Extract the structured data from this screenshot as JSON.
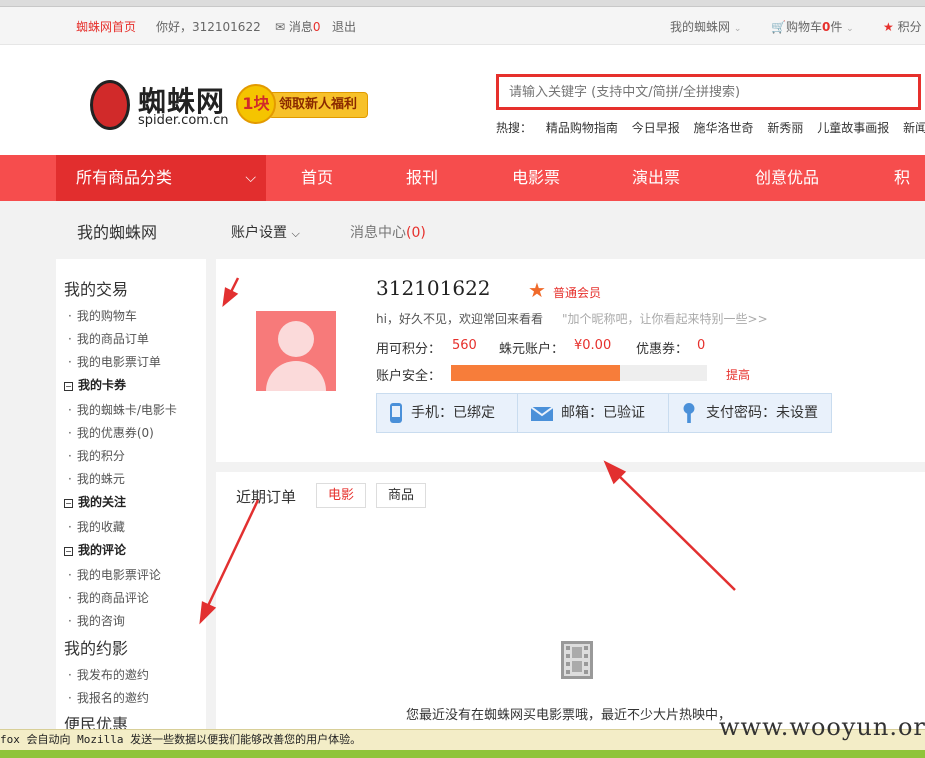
{
  "topbar": {
    "home": "蜘蛛网首页",
    "hello": "你好，312101622",
    "messages_label": "消息",
    "messages_count": "0",
    "logout": "退出",
    "my_spider": "我的蜘蛛网",
    "cart_label": "购物车",
    "cart_count": "0",
    "cart_unit": "件",
    "points": "积分"
  },
  "header": {
    "logo_text": "蜘蛛网",
    "logo_domain": "spider.com.cn",
    "promo_amount": "1块",
    "promo_text": "领取新人福利"
  },
  "search": {
    "placeholder": "请输入关键字 (支持中文/简拼/全拼搜索)",
    "hot_label": "热搜：",
    "hot": [
      "精品购物指南",
      "今日早报",
      "施华洛世奇",
      "新秀丽",
      "儿童故事画报",
      "新闻晨"
    ]
  },
  "nav": {
    "all_categories": "所有商品分类",
    "items": [
      "首页",
      "报刊",
      "电影票",
      "演出票",
      "创意优品",
      "积分"
    ]
  },
  "subnav": {
    "title": "我的蜘蛛网",
    "account": "账户设置",
    "messages": "消息中心",
    "messages_count": "(0)"
  },
  "sidebar": {
    "trade": "我的交易",
    "cart": "我的购物车",
    "goods_orders": "我的商品订单",
    "movie_orders": "我的电影票订单",
    "cards": "我的卡券",
    "spider_card": "我的蜘蛛卡/电影卡",
    "coupons": "我的优惠券(0)",
    "points": "我的积分",
    "spider_yuan": "我的蛛元",
    "follows": "我的关注",
    "favorites": "我的收藏",
    "reviews": "我的评论",
    "movie_reviews": "我的电影票评论",
    "goods_reviews": "我的商品评论",
    "consult": "我的咨询",
    "dates": "我的约影",
    "published": "我发布的邀约",
    "joined": "我报名的邀约",
    "convenience": "便民优惠"
  },
  "profile": {
    "username": "312101622",
    "member_level": "普通会员",
    "greeting": "hi，好久不见，欢迎常回来看看",
    "nickname_hint": "\"加个昵称吧，让你看起来特别一些>>",
    "points_label": "用可积分：",
    "points_value": "560",
    "spider_label": "蛛元账户：",
    "spider_value": "¥0.00",
    "coupon_label": "优惠券：",
    "coupon_value": "0",
    "security_label": "账户安全：",
    "security_level": 0.66,
    "security_upgrade": "提高",
    "phone": "手机：已绑定",
    "email": "邮箱：已验证",
    "paypwd": "支付密码：未设置"
  },
  "orders": {
    "title": "近期订单",
    "tab_movie": "电影",
    "tab_goods": "商品",
    "empty_text": "您最近没有在蜘蛛网买电影票哦，最近不少大片热映中，"
  },
  "notification": "fox 会自动向 Mozilla 发送一些数据以便我们能够改善您的用户体验。",
  "watermark": "www.wooyun.org",
  "colors": {
    "brand_red": "#e6302c",
    "nav_red": "#f64d4d",
    "security_fill": "#f77d3a"
  }
}
